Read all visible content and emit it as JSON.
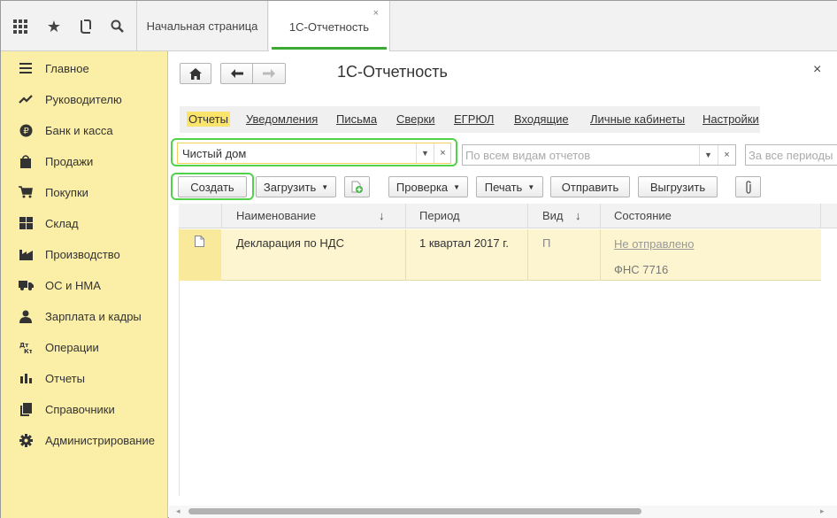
{
  "tabs": {
    "home": "Начальная страница",
    "active": "1С-Отчетность",
    "close": "×"
  },
  "toolbar_icons": [
    "apps-grid-icon",
    "star-icon",
    "history-icon",
    "search-icon"
  ],
  "sidebar": {
    "items": [
      {
        "label": "Главное",
        "icon": "≡"
      },
      {
        "label": "Руководителю",
        "icon": "↗"
      },
      {
        "label": "Банк и касса",
        "icon": "₽"
      },
      {
        "label": "Продажи",
        "icon": "▣"
      },
      {
        "label": "Покупки",
        "icon": "⛟"
      },
      {
        "label": "Склад",
        "icon": "▦"
      },
      {
        "label": "Производство",
        "icon": "▙"
      },
      {
        "label": "ОС и НМА",
        "icon": "⛟"
      },
      {
        "label": "Зарплата и кадры",
        "icon": "☻"
      },
      {
        "label": "Операции",
        "icon": "Дт"
      },
      {
        "label": "Отчеты",
        "icon": "▮"
      },
      {
        "label": "Справочники",
        "icon": "❐"
      },
      {
        "label": "Администрирование",
        "icon": "⚙"
      }
    ]
  },
  "main": {
    "title": "1С-Отчетность",
    "close": "×",
    "nav": [
      {
        "label": "Отчеты",
        "active": true
      },
      {
        "label": "Уведомления"
      },
      {
        "label": "Письма"
      },
      {
        "label": "Сверки"
      },
      {
        "label": "ЕГРЮЛ"
      },
      {
        "label": "Входящие"
      },
      {
        "label": "Личные кабинеты"
      },
      {
        "label": "Настройки"
      }
    ],
    "filters": {
      "org_value": "Чистый дом",
      "type_placeholder": "По всем видам отчетов",
      "period_placeholder": "За все периоды"
    },
    "buttons": {
      "create": "Создать",
      "load": "Загрузить",
      "check": "Проверка",
      "print": "Печать",
      "send": "Отправить",
      "export": "Выгрузить"
    },
    "table": {
      "columns": {
        "name": "Наименование",
        "period": "Период",
        "kind": "Вид",
        "state": "Состояние"
      },
      "rows": [
        {
          "name": "Декларация по НДС",
          "period": "1 квартал 2017 г.",
          "kind": "П",
          "state": "Не отправлено",
          "recipient": "ФНС 7716"
        }
      ]
    }
  },
  "colors": {
    "sidebar_bg": "#fbeea6",
    "accent_green": "#3aaa35",
    "highlight_ring": "#52d14a",
    "active_nav_bg": "#fbe46b",
    "row_selected_bg": "#fcf5cf"
  }
}
